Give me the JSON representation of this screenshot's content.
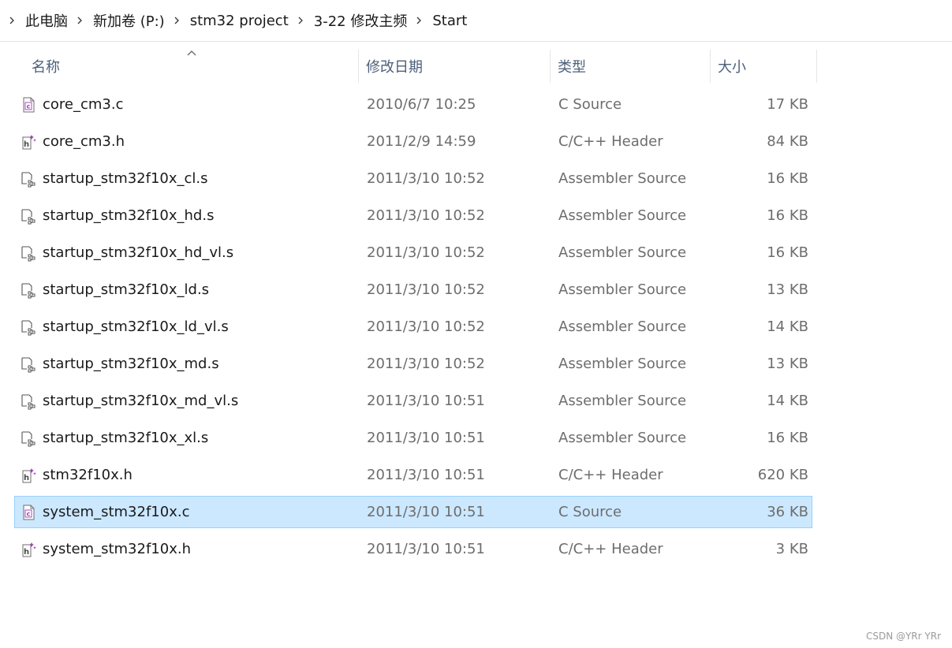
{
  "breadcrumb": [
    {
      "label": "此电脑"
    },
    {
      "label": "新加卷 (P:)"
    },
    {
      "label": "stm32 project"
    },
    {
      "label": "3-22 修改主频"
    },
    {
      "label": "Start"
    }
  ],
  "columns": {
    "name": "名称",
    "date": "修改日期",
    "type": "类型",
    "size": "大小",
    "sort": "name-ascending"
  },
  "files": [
    {
      "name": "core_cm3.c",
      "date": "2010/6/7 10:25",
      "type": "C Source",
      "size": "17 KB",
      "icon": "c-source-icon"
    },
    {
      "name": "core_cm3.h",
      "date": "2011/2/9 14:59",
      "type": "C/C++ Header",
      "size": "84 KB",
      "icon": "header-icon"
    },
    {
      "name": "startup_stm32f10x_cl.s",
      "date": "2011/3/10 10:52",
      "type": "Assembler Source",
      "size": "16 KB",
      "icon": "assembler-icon"
    },
    {
      "name": "startup_stm32f10x_hd.s",
      "date": "2011/3/10 10:52",
      "type": "Assembler Source",
      "size": "16 KB",
      "icon": "assembler-icon"
    },
    {
      "name": "startup_stm32f10x_hd_vl.s",
      "date": "2011/3/10 10:52",
      "type": "Assembler Source",
      "size": "16 KB",
      "icon": "assembler-icon"
    },
    {
      "name": "startup_stm32f10x_ld.s",
      "date": "2011/3/10 10:52",
      "type": "Assembler Source",
      "size": "13 KB",
      "icon": "assembler-icon"
    },
    {
      "name": "startup_stm32f10x_ld_vl.s",
      "date": "2011/3/10 10:52",
      "type": "Assembler Source",
      "size": "14 KB",
      "icon": "assembler-icon"
    },
    {
      "name": "startup_stm32f10x_md.s",
      "date": "2011/3/10 10:52",
      "type": "Assembler Source",
      "size": "13 KB",
      "icon": "assembler-icon"
    },
    {
      "name": "startup_stm32f10x_md_vl.s",
      "date": "2011/3/10 10:51",
      "type": "Assembler Source",
      "size": "14 KB",
      "icon": "assembler-icon"
    },
    {
      "name": "startup_stm32f10x_xl.s",
      "date": "2011/3/10 10:51",
      "type": "Assembler Source",
      "size": "16 KB",
      "icon": "assembler-icon"
    },
    {
      "name": "stm32f10x.h",
      "date": "2011/3/10 10:51",
      "type": "C/C++ Header",
      "size": "620 KB",
      "icon": "header-icon"
    },
    {
      "name": "system_stm32f10x.c",
      "date": "2011/3/10 10:51",
      "type": "C Source",
      "size": "36 KB",
      "icon": "c-source-icon",
      "selected": true
    },
    {
      "name": "system_stm32f10x.h",
      "date": "2011/3/10 10:51",
      "type": "C/C++ Header",
      "size": "3 KB",
      "icon": "header-icon"
    }
  ],
  "watermark": "CSDN @YRr YRr",
  "colors": {
    "selection_bg": "#cce8ff",
    "selection_border": "#99d1ff",
    "header_text": "#4c607a",
    "secondary_text": "#6d6d6d"
  }
}
